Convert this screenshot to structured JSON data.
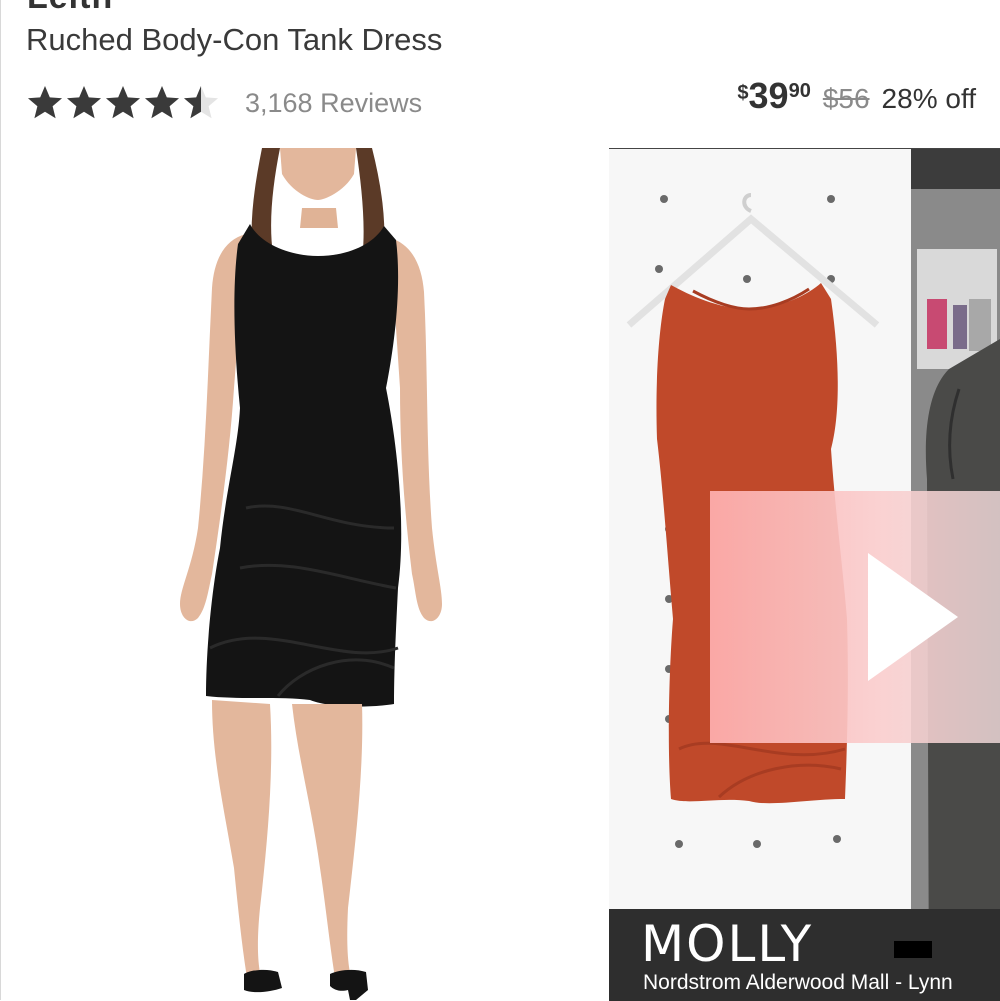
{
  "product": {
    "brand": "Leith",
    "title": "Ruched Body-Con Tank Dress",
    "rating": {
      "value": 4.5,
      "max": 5,
      "reviews_label": "3,168 Reviews"
    }
  },
  "price": {
    "currency": "$",
    "dollars": "39",
    "cents": "90",
    "original": "$56",
    "discount": "28% off"
  },
  "video": {
    "caption_name": "MOLLY",
    "caption_location": "Nordstrom Alderwood Mall - Lynn"
  },
  "colors": {
    "text": "#333333",
    "muted": "#8a8a8a",
    "star": "#3a3a3a",
    "dress_main": "#141414",
    "dress_video": "#c0492a",
    "play_overlay": "#ffb0b0"
  },
  "icons": {
    "star": "star-icon",
    "play": "play-icon"
  }
}
